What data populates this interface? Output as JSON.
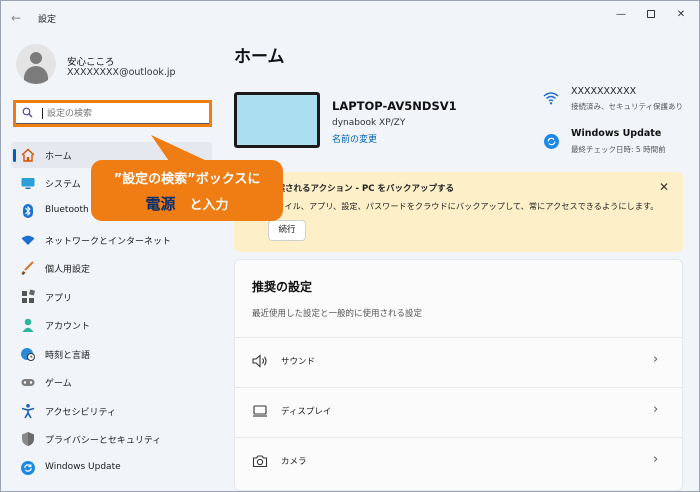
{
  "window": {
    "title": "設定",
    "back": "←",
    "minimize": "—",
    "close": "✕"
  },
  "user": {
    "name": "安心こころ",
    "email": "XXXXXXXX@outlook.jp"
  },
  "search": {
    "placeholder": "設定の検索"
  },
  "sidebar": {
    "items": [
      {
        "label": "ホーム",
        "icon": "home-icon",
        "active": true
      },
      {
        "label": "システム",
        "icon": "monitor-icon"
      },
      {
        "label": "Bluetooth",
        "icon": "bluetooth-icon"
      },
      {
        "label": "ネットワークとインターネット",
        "icon": "network-icon"
      },
      {
        "label": "個人用設定",
        "icon": "brush-icon"
      },
      {
        "label": "アプリ",
        "icon": "apps-icon"
      },
      {
        "label": "アカウント",
        "icon": "account-icon"
      },
      {
        "label": "時刻と言語",
        "icon": "globe-clock-icon"
      },
      {
        "label": "ゲーム",
        "icon": "gamepad-icon"
      },
      {
        "label": "アクセシビリティ",
        "icon": "accessibility-icon"
      },
      {
        "label": "プライバシーとセキュリティ",
        "icon": "shield-icon"
      },
      {
        "label": "Windows Update",
        "icon": "update-icon"
      }
    ]
  },
  "callout": {
    "line1": "”設定の検索”ボックスに",
    "highlight": "電源",
    "line2_rest": "と入力",
    "color": "#ef7d14",
    "highlight_color": "#0a2e6e"
  },
  "main": {
    "title": "ホーム",
    "device": {
      "name": "LAPTOP-AV5NDSV1",
      "model": "dynabook XP/ZY",
      "rename": "名前の変更"
    },
    "status": {
      "wifi_name": "XXXXXXXXXX",
      "wifi_status": "接続済み、セキュリティ保護あり",
      "update_title": "Windows Update",
      "update_status": "最終チェック日時: 5 時間前"
    },
    "banner": {
      "title": "提案されるアクション - PC をバックアップする",
      "text": "ファイル、アプリ、設定、パスワードをクラウドにバックアップして、常にアクセスできるようにします。",
      "button": "続行",
      "close": "✕"
    },
    "recommended": {
      "title": "推奨の設定",
      "subtitle": "最近使用した設定と一般的に使用される設定",
      "items": [
        {
          "label": "サウンド",
          "icon": "speaker-icon"
        },
        {
          "label": "ディスプレイ",
          "icon": "display-icon"
        },
        {
          "label": "カメラ",
          "icon": "camera-icon"
        }
      ],
      "chevron": "›"
    }
  },
  "colors": {
    "accent": "#005fb8",
    "highlight_border": "#ef7d14",
    "banner_bg": "#fdf0c9"
  }
}
